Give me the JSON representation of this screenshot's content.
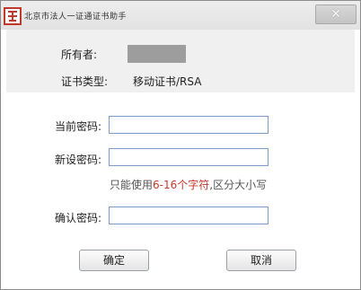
{
  "window": {
    "title": "北京市法人一证通证书助手",
    "close_symbol": "✕"
  },
  "info": {
    "owner_label": "所有者:",
    "cert_type_label": "证书类型:",
    "cert_type_value": "移动证书/RSA"
  },
  "form": {
    "current_password_label": "当前密码:",
    "current_password_value": "",
    "new_password_label": "新设密码:",
    "new_password_value": "",
    "hint_prefix": "只能使用",
    "hint_highlight": "6-16个字符",
    "hint_suffix": ",区分大小写",
    "confirm_password_label": "确认密码:",
    "confirm_password_value": ""
  },
  "buttons": {
    "ok": "确定",
    "cancel": "取消"
  },
  "colors": {
    "accent": "#c0392b",
    "field_border": "#7a9cc6"
  }
}
